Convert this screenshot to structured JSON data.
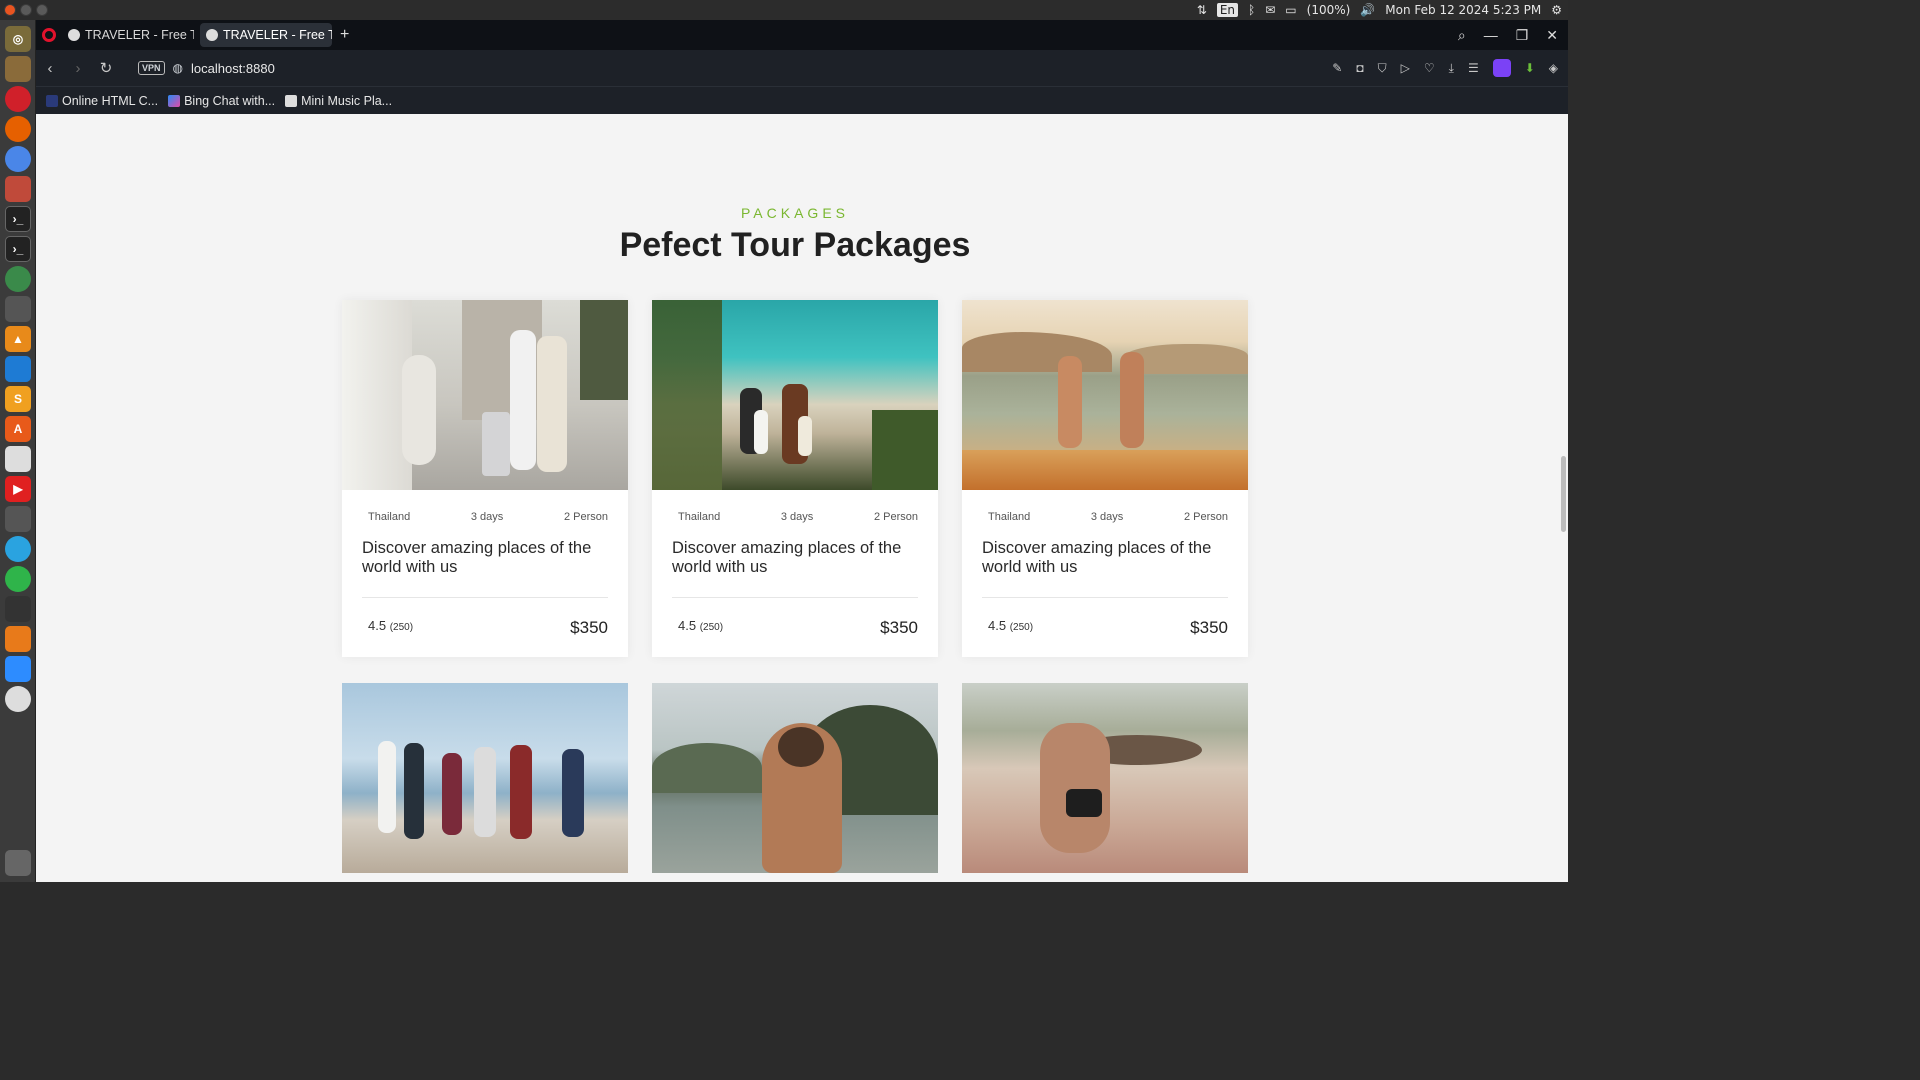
{
  "os": {
    "datetime": "Mon Feb 12 2024  5:23 PM",
    "battery": "(100%)",
    "language": "En"
  },
  "browser": {
    "tabs": [
      {
        "label": "TRAVELER - Free Tra"
      },
      {
        "label": "TRAVELER - Free Tra"
      }
    ],
    "new_tab": "+",
    "url": "localhost:8880",
    "vpn": "VPN",
    "bookmarks": [
      {
        "label": "Online HTML C..."
      },
      {
        "label": "Bing Chat with..."
      },
      {
        "label": "Mini Music Pla..."
      }
    ]
  },
  "section": {
    "eyebrow": "PACKAGES",
    "title": "Pefect Tour Packages"
  },
  "packages": [
    {
      "location": "Thailand",
      "duration": "3 days",
      "people": "2 Person",
      "title": "Discover amazing places of the world with us",
      "rating": "4.5",
      "reviews": "(250)",
      "price": "$350",
      "image": "couple-luggage-street"
    },
    {
      "location": "Thailand",
      "duration": "3 days",
      "people": "2 Person",
      "title": "Discover amazing places of the world with us",
      "rating": "4.5",
      "reviews": "(250)",
      "price": "$350",
      "image": "surfers-beach-path"
    },
    {
      "location": "Thailand",
      "duration": "3 days",
      "people": "2 Person",
      "title": "Discover amazing places of the world with us",
      "rating": "4.5",
      "reviews": "(250)",
      "price": "$350",
      "image": "women-sea-waves"
    }
  ],
  "row2_images": [
    "friends-beach",
    "woman-bay-cliffs",
    "woman-sand-boat"
  ],
  "colors": {
    "accent": "#7ab730",
    "page_bg": "#f4f4f4"
  }
}
